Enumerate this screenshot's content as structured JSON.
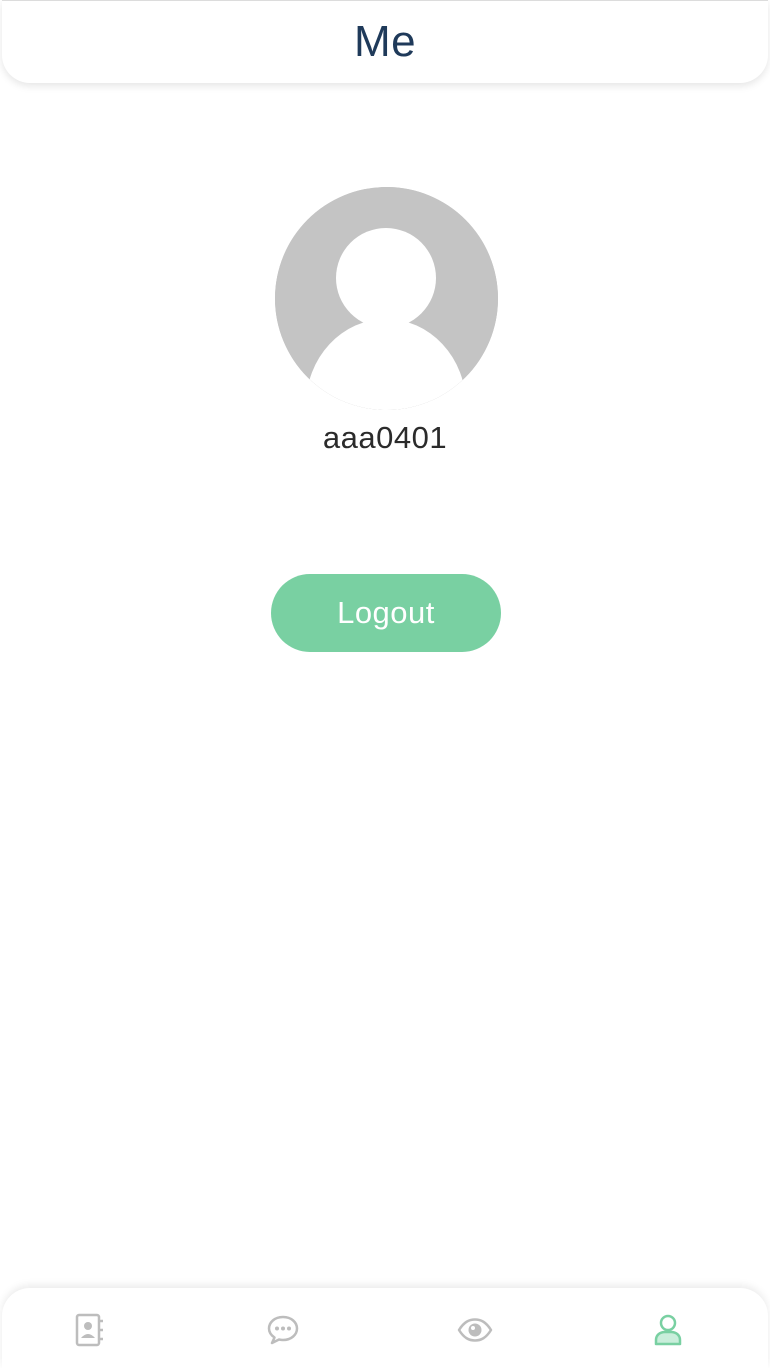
{
  "header": {
    "title": "Me"
  },
  "profile": {
    "username": "aaa0401",
    "avatar_icon": "default-avatar-icon"
  },
  "actions": {
    "logout_label": "Logout"
  },
  "tabbar": {
    "items": [
      {
        "icon": "contacts-icon",
        "active": false
      },
      {
        "icon": "chat-bubble-icon",
        "active": false
      },
      {
        "icon": "eye-icon",
        "active": false
      },
      {
        "icon": "user-icon",
        "active": true
      }
    ]
  },
  "colors": {
    "accent": "#79d0a2",
    "title": "#1f3a5a",
    "inactive_icon": "#bdbdbd",
    "avatar_bg": "#c4c4c4"
  }
}
